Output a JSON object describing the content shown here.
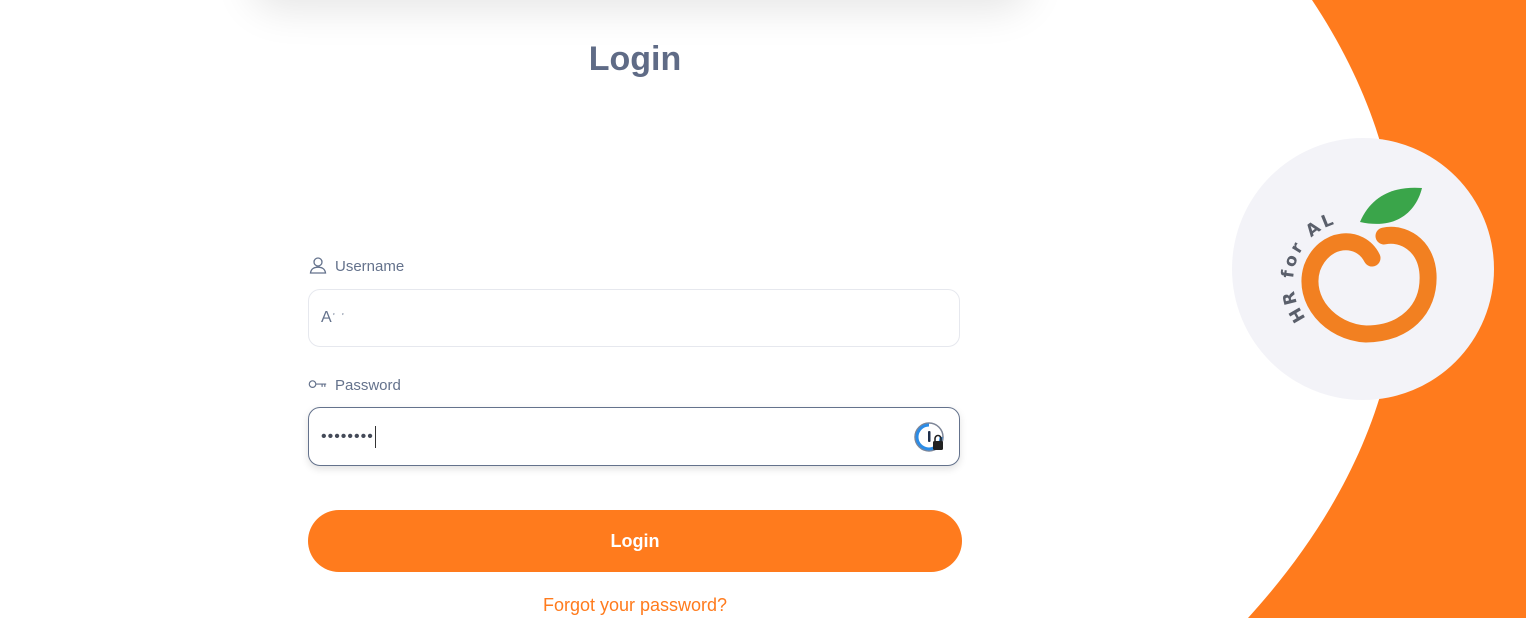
{
  "login_form": {
    "title": "Login",
    "username": {
      "label": "Username",
      "value": "Aˑ ˑ"
    },
    "password": {
      "label": "Password",
      "value": "••••••••"
    },
    "submit_label": "Login",
    "forgot_password_label": "Forgot your password?"
  },
  "branding": {
    "logo_text": "HR for ALL"
  },
  "colors": {
    "accent": "#ff7b1d",
    "title_text": "#5f6b86",
    "label_text": "#64728c",
    "logo_circle": "#f3f3f8",
    "leaf": "#3aa54a",
    "orange_logo": "#f28021"
  },
  "icons": {
    "username_label_icon": "user-icon",
    "password_label_icon": "key-icon",
    "password_manager_icon": "password-manager-lock-icon",
    "brand_logo": "orange-hr-for-all-logo"
  }
}
